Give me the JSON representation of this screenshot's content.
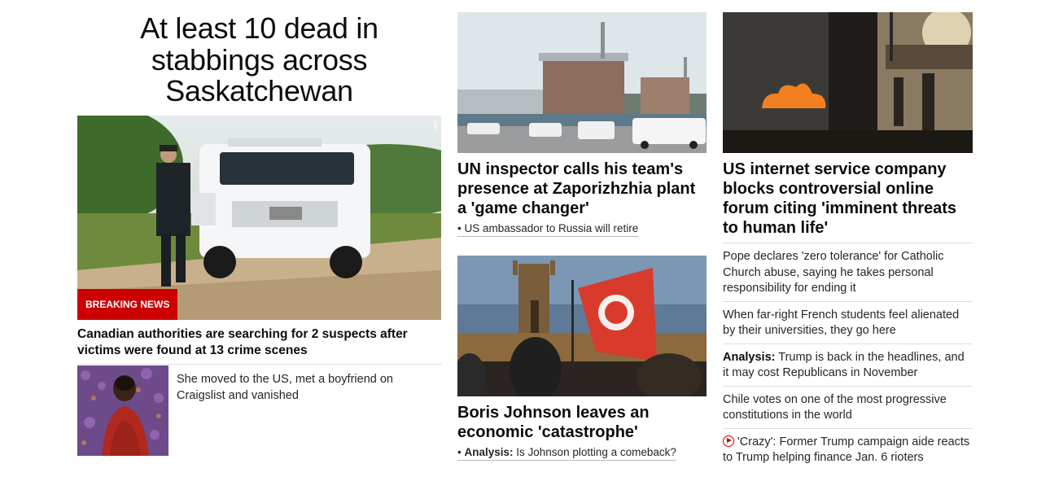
{
  "main_story": {
    "headline": "At least 10 dead in stabbings across Saskatchewan",
    "badge": "BREAKING NEWS",
    "photo_credit": "CBC",
    "caption": "Canadian authorities are searching for 2 suspects after victims were found at 13 crime scenes",
    "related": "She moved to the US, met a boyfriend on Craigslist and vanished"
  },
  "center_stories": [
    {
      "headline": "UN inspector calls his team's presence at Zaporizhzhia plant a 'game changer'",
      "sub_link": "US ambassador to Russia will retire"
    },
    {
      "headline": "Boris Johnson leaves an economic 'catastrophe'",
      "sub_prefix": "Analysis:",
      "sub_link": "Is Johnson plotting a comeback?"
    }
  ],
  "right_column": {
    "headline": "US internet service company blocks controversial online forum citing 'imminent threats to human life'",
    "items": [
      {
        "prefix": "",
        "text": "Pope declares 'zero tolerance' for Catholic Church abuse, saying he takes personal responsibility for ending it"
      },
      {
        "prefix": "",
        "text": "When far-right French students feel alienated by their universities, they go here"
      },
      {
        "prefix": "Analysis:",
        "text": "Trump is back in the headlines, and it may cost Republicans in November"
      },
      {
        "prefix": "",
        "text": "Chile votes on one of the most progressive constitutions in the world"
      },
      {
        "prefix": "",
        "text": "'Crazy': Former Trump campaign aide reacts to Trump helping finance Jan. 6 rioters"
      }
    ]
  },
  "colors": {
    "breaking": "#cc0000",
    "text": "#0c0c0c",
    "divider": "#dddddd"
  },
  "icons": {
    "video": "play-circle-icon"
  }
}
